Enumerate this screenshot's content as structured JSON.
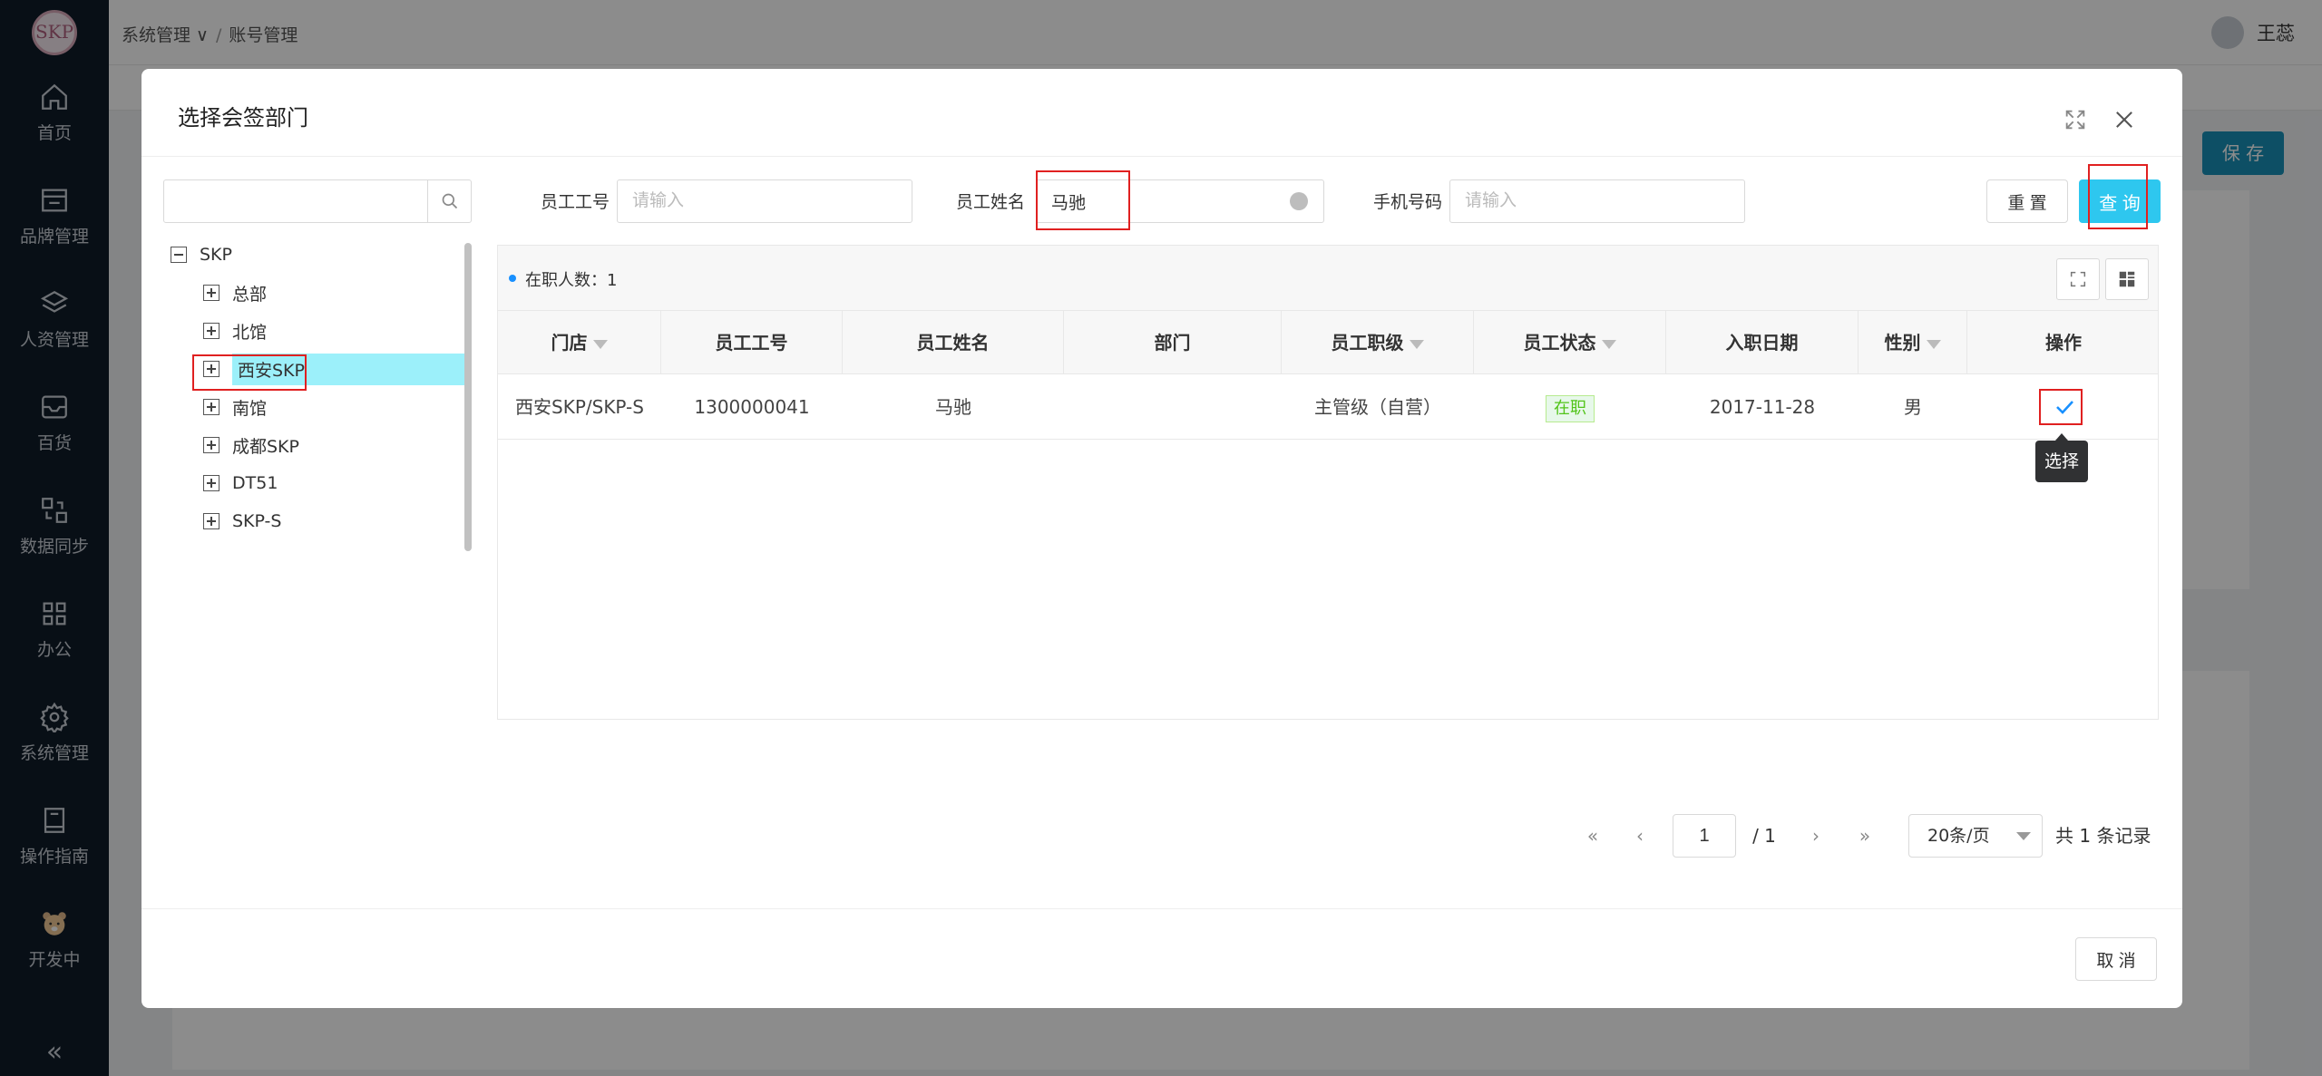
{
  "sidebar": {
    "logo_text": "SKP",
    "items": [
      {
        "label": "首页",
        "icon": "home-icon"
      },
      {
        "label": "品牌管理",
        "icon": "store-icon"
      },
      {
        "label": "人资管理",
        "icon": "layers-icon"
      },
      {
        "label": "百货",
        "icon": "inbox-icon"
      },
      {
        "label": "数据同步",
        "icon": "sync-icon"
      },
      {
        "label": "办公",
        "icon": "grid-icon"
      },
      {
        "label": "系统管理",
        "icon": "gear-icon"
      },
      {
        "label": "操作指南",
        "icon": "book-icon"
      },
      {
        "label": "开发中",
        "icon": "bear-icon"
      }
    ],
    "collapse": "«"
  },
  "topbar": {
    "breadcrumb": [
      "系统管理",
      "账号管理"
    ],
    "user_name": "王蕊",
    "save_label": "保 存"
  },
  "modal": {
    "title": "选择会签部门",
    "tree": {
      "search_value": "",
      "nodes": [
        {
          "label": "SKP",
          "expanded": true
        },
        {
          "label": "总部",
          "expanded": false
        },
        {
          "label": "北馆",
          "expanded": false
        },
        {
          "label": "西安SKP",
          "expanded": false,
          "selected": true
        },
        {
          "label": "南馆",
          "expanded": false
        },
        {
          "label": "成都SKP",
          "expanded": false
        },
        {
          "label": "DT51",
          "expanded": false
        },
        {
          "label": "SKP-S",
          "expanded": false
        }
      ]
    },
    "filters": {
      "emp_no_label": "员工工号",
      "emp_no_placeholder": "请输入",
      "emp_name_label": "员工姓名",
      "emp_name_value": "马驰",
      "phone_label": "手机号码",
      "phone_placeholder": "请输入",
      "reset_label": "重 置",
      "query_label": "查 询"
    },
    "table": {
      "count_text": "在职人数：1",
      "columns": [
        "门店",
        "员工工号",
        "员工姓名",
        "部门",
        "员工职级",
        "员工状态",
        "入职日期",
        "性别",
        "操作"
      ],
      "filterable": [
        true,
        false,
        false,
        false,
        true,
        true,
        false,
        true,
        false
      ],
      "rows": [
        {
          "store": "西安SKP/SKP-S",
          "emp_no": "1300000041",
          "name": "马驰",
          "dept": "",
          "level": "主管级（自营）",
          "status": "在职",
          "join_date": "2017-11-28",
          "gender": "男"
        }
      ],
      "action_tooltip": "选择"
    },
    "pagination": {
      "first": "«",
      "prev": "‹",
      "current": "1",
      "total_pages": "/ 1",
      "next": "›",
      "last": "»",
      "page_size": "20条/页",
      "total_text": "共 1 条记录"
    },
    "cancel_label": "取 消"
  }
}
